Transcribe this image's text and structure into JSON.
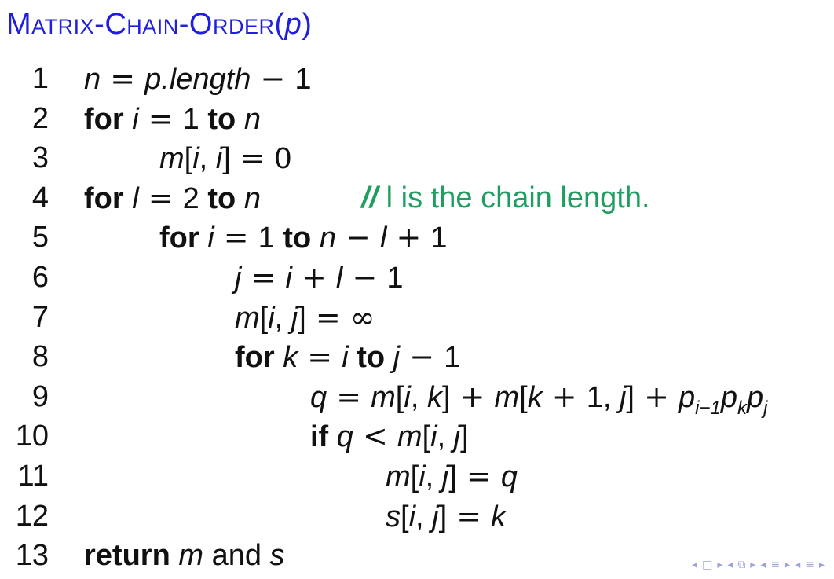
{
  "title": {
    "name": "Matrix-Chain-Order",
    "open": "(",
    "arg": "p",
    "close": ")"
  },
  "lines": [
    {
      "num": "1",
      "indent": 0,
      "parts": [
        [
          "v",
          "n"
        ],
        [
          "op",
          " = "
        ],
        [
          "v",
          "p.length"
        ],
        [
          "op",
          " − "
        ],
        [
          "t",
          "1"
        ]
      ]
    },
    {
      "num": "2",
      "indent": 0,
      "parts": [
        [
          "kw",
          "for "
        ],
        [
          "v",
          "i"
        ],
        [
          "op",
          " = "
        ],
        [
          "t",
          "1 "
        ],
        [
          "kw",
          "to "
        ],
        [
          "v",
          "n"
        ]
      ]
    },
    {
      "num": "3",
      "indent": 1,
      "parts": [
        [
          "v",
          "m"
        ],
        [
          "t",
          "["
        ],
        [
          "v",
          "i"
        ],
        [
          "t",
          ", "
        ],
        [
          "v",
          "i"
        ],
        [
          "t",
          "]"
        ],
        [
          "op",
          " = "
        ],
        [
          "t",
          "0"
        ]
      ]
    },
    {
      "num": "4",
      "indent": 0,
      "parts": [
        [
          "kw",
          "for "
        ],
        [
          "v",
          "l"
        ],
        [
          "op",
          " = "
        ],
        [
          "t",
          "2 "
        ],
        [
          "kw",
          "to "
        ],
        [
          "v",
          "n"
        ]
      ],
      "comment": {
        "slash": "//",
        "text": " l is the chain length."
      }
    },
    {
      "num": "5",
      "indent": 1,
      "parts": [
        [
          "kw",
          "for "
        ],
        [
          "v",
          "i"
        ],
        [
          "op",
          " = "
        ],
        [
          "t",
          "1 "
        ],
        [
          "kw",
          "to "
        ],
        [
          "v",
          "n"
        ],
        [
          "op",
          " − "
        ],
        [
          "v",
          "l"
        ],
        [
          "op",
          " + "
        ],
        [
          "t",
          "1"
        ]
      ]
    },
    {
      "num": "6",
      "indent": 2,
      "parts": [
        [
          "v",
          "j"
        ],
        [
          "op",
          " = "
        ],
        [
          "v",
          "i"
        ],
        [
          "op",
          " + "
        ],
        [
          "v",
          "l"
        ],
        [
          "op",
          " − "
        ],
        [
          "t",
          "1"
        ]
      ]
    },
    {
      "num": "7",
      "indent": 2,
      "parts": [
        [
          "v",
          "m"
        ],
        [
          "t",
          "["
        ],
        [
          "v",
          "i"
        ],
        [
          "t",
          ", "
        ],
        [
          "v",
          "j"
        ],
        [
          "t",
          "]"
        ],
        [
          "op",
          " = "
        ],
        [
          "op",
          "∞"
        ]
      ]
    },
    {
      "num": "8",
      "indent": 2,
      "parts": [
        [
          "kw",
          "for "
        ],
        [
          "v",
          "k"
        ],
        [
          "op",
          " = "
        ],
        [
          "v",
          "i "
        ],
        [
          "kw",
          "to "
        ],
        [
          "v",
          "j"
        ],
        [
          "op",
          " − "
        ],
        [
          "t",
          "1"
        ]
      ]
    },
    {
      "num": "9",
      "indent": 3,
      "parts": [
        [
          "v",
          "q"
        ],
        [
          "op",
          " = "
        ],
        [
          "v",
          "m"
        ],
        [
          "t",
          "["
        ],
        [
          "v",
          "i"
        ],
        [
          "t",
          ", "
        ],
        [
          "v",
          "k"
        ],
        [
          "t",
          "]"
        ],
        [
          "op",
          " + "
        ],
        [
          "v",
          "m"
        ],
        [
          "t",
          "["
        ],
        [
          "v",
          "k"
        ],
        [
          "op",
          " + "
        ],
        [
          "t",
          "1, "
        ],
        [
          "v",
          "j"
        ],
        [
          "t",
          "]"
        ],
        [
          "op",
          " + "
        ],
        [
          "v",
          "p"
        ],
        [
          "sub",
          "i−1"
        ],
        [
          "v",
          "p"
        ],
        [
          "sub",
          "k"
        ],
        [
          "v",
          "p"
        ],
        [
          "sub",
          "j"
        ]
      ]
    },
    {
      "num": "10",
      "indent": 3,
      "parts": [
        [
          "kw",
          "if "
        ],
        [
          "v",
          "q"
        ],
        [
          "op",
          " < "
        ],
        [
          "v",
          "m"
        ],
        [
          "t",
          "["
        ],
        [
          "v",
          "i"
        ],
        [
          "t",
          ", "
        ],
        [
          "v",
          "j"
        ],
        [
          "t",
          "]"
        ]
      ]
    },
    {
      "num": "11",
      "indent": 4,
      "parts": [
        [
          "v",
          "m"
        ],
        [
          "t",
          "["
        ],
        [
          "v",
          "i"
        ],
        [
          "t",
          ", "
        ],
        [
          "v",
          "j"
        ],
        [
          "t",
          "]"
        ],
        [
          "op",
          " = "
        ],
        [
          "v",
          "q"
        ]
      ]
    },
    {
      "num": "12",
      "indent": 4,
      "parts": [
        [
          "v",
          "s"
        ],
        [
          "t",
          "["
        ],
        [
          "v",
          "i"
        ],
        [
          "t",
          ", "
        ],
        [
          "v",
          "j"
        ],
        [
          "t",
          "]"
        ],
        [
          "op",
          " = "
        ],
        [
          "v",
          "k"
        ]
      ]
    },
    {
      "num": "13",
      "indent": 0,
      "parts": [
        [
          "kw",
          "return "
        ],
        [
          "v",
          "m"
        ],
        [
          "t",
          " and "
        ],
        [
          "v",
          "s"
        ]
      ]
    }
  ],
  "nav": {
    "icons": [
      "nav-prev-icon",
      "frame-icon",
      "nav-next-icon",
      "nav-prev-icon",
      "subsection-icon",
      "nav-next-icon",
      "nav-prev-icon",
      "section-icon",
      "nav-next-icon",
      "nav-prev-icon",
      "outline-icon",
      "nav-next-icon"
    ],
    "glyphs": [
      "◂",
      "□",
      "▸",
      "◂",
      "⧉",
      "▸",
      "◂",
      "≡",
      "▸",
      "◂",
      "≡",
      "▸"
    ]
  }
}
